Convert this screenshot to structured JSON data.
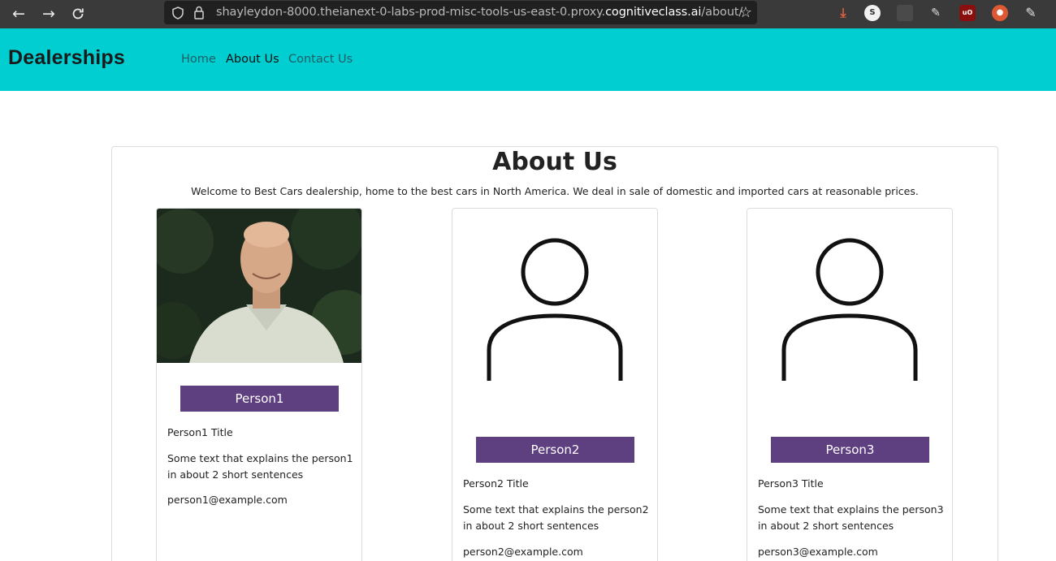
{
  "browser": {
    "url_prefix": "shayleydon-8000.theianext-0-labs-prod-misc-tools-us-east-0.proxy.",
    "url_domain": "cognitiveclass.ai",
    "url_path": "/about/",
    "back_icon": "arrow-left-icon",
    "forward_icon": "arrow-right-icon",
    "reload_icon": "reload-icon",
    "bookmark_icon": "star-icon",
    "extensions": [
      "download-icon",
      "s-extension-icon",
      "blank-extension-icon",
      "bug-extension-icon",
      "ublock-icon",
      "duckduckgo-icon",
      "puzzle-icon",
      "sidebar-icon"
    ],
    "ext_s_label": "S",
    "ext_ublock_label": "uO"
  },
  "nav": {
    "brand": "Dealerships",
    "links": [
      {
        "label": "Home",
        "active": false
      },
      {
        "label": "About Us",
        "active": true
      },
      {
        "label": "Contact Us",
        "active": false
      }
    ],
    "bg_color": "#00ced1"
  },
  "about": {
    "title": "About Us",
    "intro": "Welcome to Best Cars dealership, home to the best cars in North America. We deal in sale of domestic and imported cars at reasonable prices."
  },
  "people": [
    {
      "name": "Person1",
      "title": "Person1 Title",
      "desc": "Some text that explains the person1 in about 2 short sentences",
      "email": "person1@example.com",
      "image": "photo"
    },
    {
      "name": "Person2",
      "title": "Person2 Title",
      "desc": "Some text that explains the person2 in about 2 short sentences",
      "email": "person2@example.com",
      "image": "person-outline-icon"
    },
    {
      "name": "Person3",
      "title": "Person3 Title",
      "desc": "Some text that explains the person3 in about 2 short sentences",
      "email": "person3@example.com",
      "image": "person-outline-icon"
    }
  ],
  "colors": {
    "name_bar": "#5e3f80",
    "navbar": "#00ced1"
  }
}
